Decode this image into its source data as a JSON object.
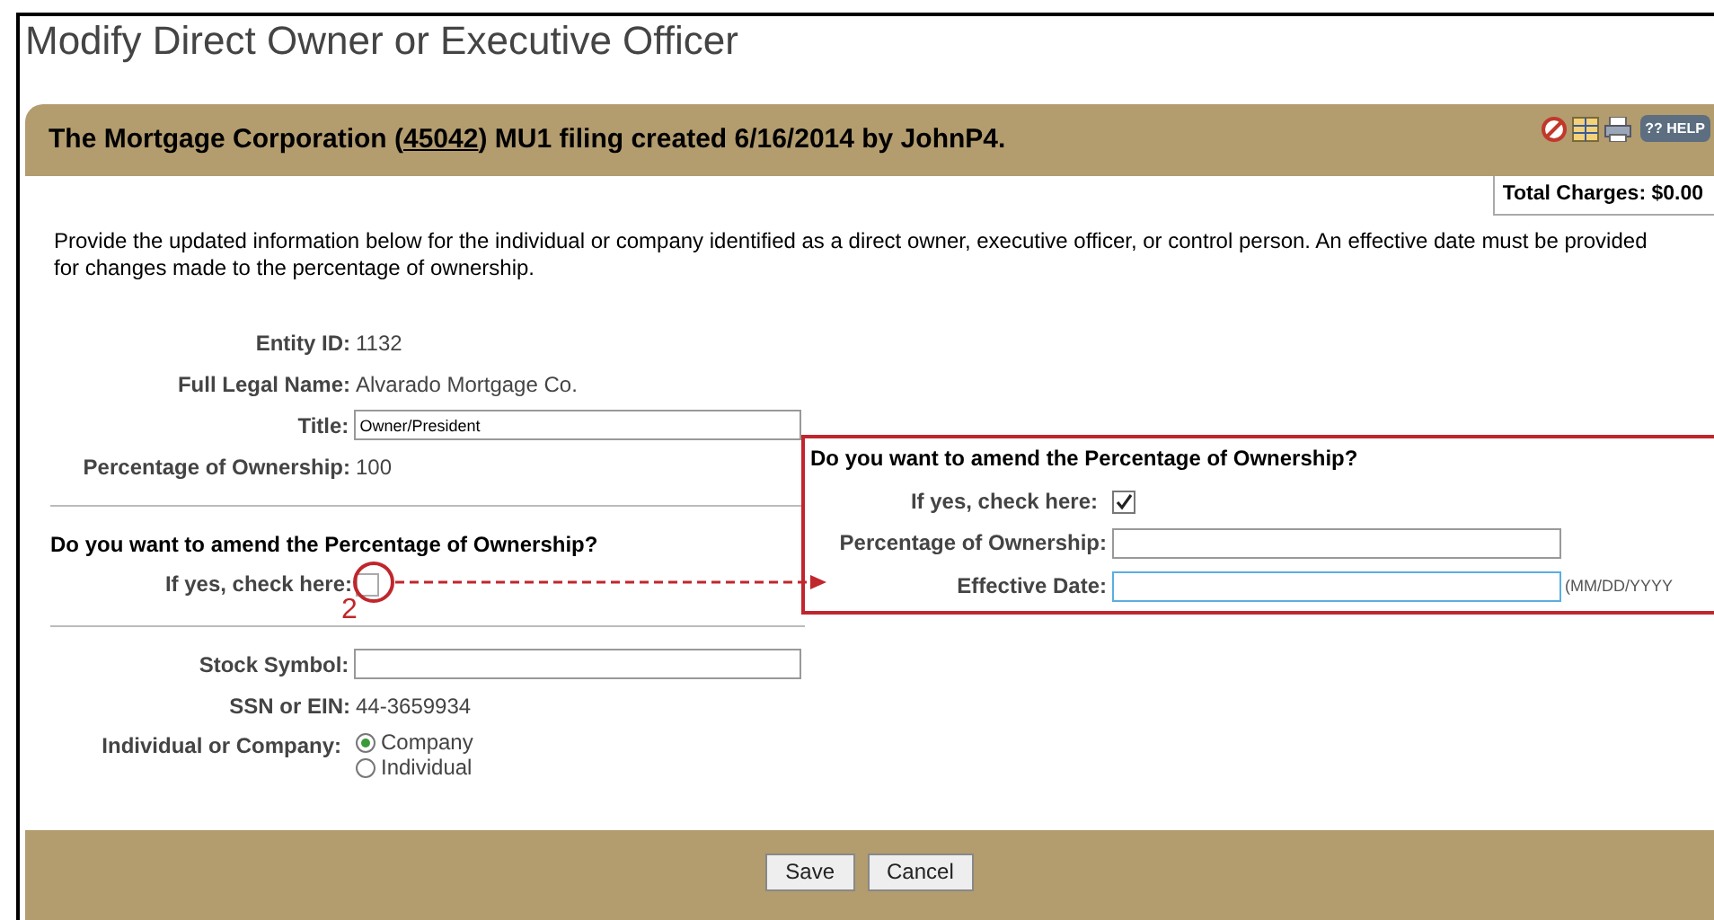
{
  "page_title": "Modify Direct Owner or Executive Officer",
  "header": {
    "prefix": "The Mortgage Corporation (",
    "link": "45042",
    "suffix": ") MU1 filing created 6/16/2014 by JohnP4.",
    "help_glyph": "??",
    "help_label": "HELP"
  },
  "total_charges": "Total Charges: $0.00",
  "intro": "Provide the updated information below for the individual or company identified as a direct owner, executive officer, or control person. An effective date must be provided for changes made to the percentage of ownership.",
  "details": [
    {
      "kind": "text",
      "label": "Entity ID:",
      "value": "1132"
    },
    {
      "kind": "text",
      "label": "Full Legal Name:",
      "value": "Alvarado Mortgage Co."
    },
    {
      "kind": "input",
      "label": "Title:",
      "value": "Owner/President"
    },
    {
      "kind": "text",
      "label": "Percentage of Ownership:",
      "value": "100"
    }
  ],
  "amend": {
    "question": "Do you want to amend the Percentage of Ownership?",
    "check_label": "If yes, check here:",
    "checked": false
  },
  "callout_number": "2",
  "details2": [
    {
      "kind": "input",
      "label": "Stock Symbol:"
    },
    {
      "kind": "text",
      "label": "SSN or EIN:",
      "value": "44-3659934"
    }
  ],
  "entity_type": {
    "label": "Individual or Company:",
    "options": [
      {
        "label": "Company",
        "selected": true
      },
      {
        "label": "Individual",
        "selected": false
      }
    ]
  },
  "expanded": {
    "question": "Do you want to amend the Percentage of Ownership?",
    "check_label": "If yes, check here:",
    "checked": true,
    "fields": [
      {
        "label": "Percentage of Ownership:",
        "focused": false
      },
      {
        "label": "Effective Date:",
        "focused": true,
        "hint": "(MM/DD/YYYY"
      }
    ]
  },
  "buttons": [
    "Save",
    "Cancel"
  ]
}
